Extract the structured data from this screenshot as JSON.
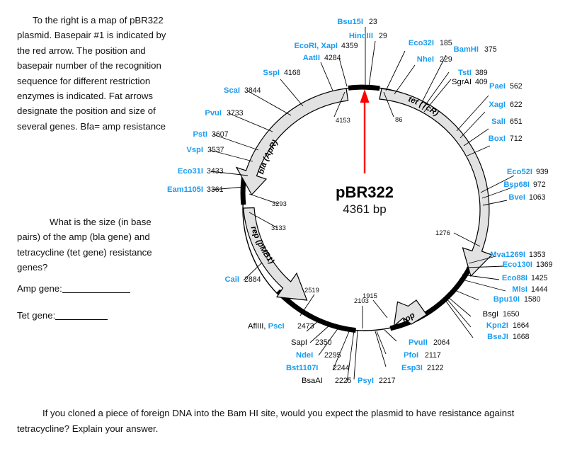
{
  "document": {
    "intro_paragraph": "To the right is a map of pBR322 plasmid.   Basepair #1 is indicated by the red arrow. The position and basepair number of the recognition sequence for different restriction enzymes is indicated.  Fat arrows designate the position and size of several genes. Bfa= amp resistance",
    "question_paragraph": "What is the size (in base pairs) of the amp (bla gene)  and tetracycline (tet gene) resistance genes?",
    "amp_blank_label": "Amp gene:",
    "tet_blank_label": "Tet gene:",
    "footer_paragraph": "If you cloned a piece of foreign DNA into the Bam HI site, would you expect the plasmid to have resistance against tetracycline?  Explain your answer."
  },
  "map": {
    "plasmid_name": "pBR322",
    "plasmid_size": "4361 bp",
    "origin_arrow_color": "#ff0000",
    "enzyme_label_color": "#1b9cf0",
    "gene_fill": "#e2e2e2",
    "backbone_color": "#000000",
    "genes": [
      {
        "name": "bla (ApR)",
        "start": 4153,
        "end": 3293
      },
      {
        "name": "tet (TcR)",
        "start": 86,
        "end": 1276
      },
      {
        "name": "rep (pMB1)",
        "start": 3133,
        "end": 2519
      },
      {
        "name": "rop",
        "start": 1915,
        "end": 2103
      }
    ],
    "gene_boundary_numbers": [
      "4153",
      "86",
      "1276",
      "3293",
      "3133",
      "2519",
      "1915",
      "2103"
    ],
    "sites": [
      {
        "enzyme": "Bsu15I",
        "position": "23",
        "blue": true
      },
      {
        "enzyme": "HindIII",
        "position": "29",
        "blue": true
      },
      {
        "enzyme": "Eco32I",
        "position": "185",
        "blue": true
      },
      {
        "enzyme": "NheI",
        "position": "229",
        "blue": true
      },
      {
        "enzyme": "BamHI",
        "position": "375",
        "blue": true
      },
      {
        "enzyme": "TstI",
        "position": "389",
        "blue": true
      },
      {
        "enzyme": "SgrAI",
        "position": "409",
        "blue": false
      },
      {
        "enzyme": "PaeI",
        "position": "562",
        "blue": true
      },
      {
        "enzyme": "XagI",
        "position": "622",
        "blue": true
      },
      {
        "enzyme": "SalI",
        "position": "651",
        "blue": true
      },
      {
        "enzyme": "BoxI",
        "position": "712",
        "blue": true
      },
      {
        "enzyme": "Eco52I",
        "position": "939",
        "blue": true
      },
      {
        "enzyme": "Bsp68I",
        "position": "972",
        "blue": true
      },
      {
        "enzyme": "BveI",
        "position": "1063",
        "blue": true
      },
      {
        "enzyme": "Mva1269I",
        "position": "1353",
        "blue": true
      },
      {
        "enzyme": "Eco130I",
        "position": "1369",
        "blue": true
      },
      {
        "enzyme": "Eco88I",
        "position": "1425",
        "blue": true
      },
      {
        "enzyme": "MlsI",
        "position": "1444",
        "blue": true
      },
      {
        "enzyme": "Bpu10I",
        "position": "1580",
        "blue": true
      },
      {
        "enzyme": "BsgI",
        "position": "1650",
        "blue": false
      },
      {
        "enzyme": "Kpn2I",
        "position": "1664",
        "blue": true
      },
      {
        "enzyme": "BseJI",
        "position": "1668",
        "blue": true
      },
      {
        "enzyme": "PvuII",
        "position": "2064",
        "blue": true
      },
      {
        "enzyme": "PfoI",
        "position": "2117",
        "blue": true
      },
      {
        "enzyme": "Esp3I",
        "position": "2122",
        "blue": true
      },
      {
        "enzyme": "PsyI",
        "position": "2217",
        "blue": true
      },
      {
        "enzyme": "BsaAI",
        "position": "2225",
        "blue": false
      },
      {
        "enzyme": "Bst1107I",
        "position": "2244",
        "blue": true
      },
      {
        "enzyme": "NdeI",
        "position": "2295",
        "blue": true
      },
      {
        "enzyme": "SapI",
        "position": "2350",
        "blue": false
      },
      {
        "enzyme": "AflIII, PscI",
        "position": "2473",
        "blue": true
      },
      {
        "enzyme": "CaiI",
        "position": "2884",
        "blue": true
      },
      {
        "enzyme": "Eam1105I",
        "position": "3361",
        "blue": true
      },
      {
        "enzyme": "Eco31I",
        "position": "3433",
        "blue": true
      },
      {
        "enzyme": "VspI",
        "position": "3537",
        "blue": true
      },
      {
        "enzyme": "PstI",
        "position": "3607",
        "blue": true
      },
      {
        "enzyme": "PvuI",
        "position": "3733",
        "blue": true
      },
      {
        "enzyme": "ScaI",
        "position": "3844",
        "blue": true
      },
      {
        "enzyme": "SspI",
        "position": "4168",
        "blue": true
      },
      {
        "enzyme": "AatII",
        "position": "4284",
        "blue": true
      },
      {
        "enzyme": "EcoRI, XapI",
        "position": "4359",
        "blue": true
      }
    ],
    "labels": {
      "top_left_group": [
        "EcoRI, XapI",
        "AatII",
        "SspI"
      ],
      "top_group": [
        "Bsu15I",
        "HindIII",
        "Eco32I",
        "NheI",
        "BamHI",
        "TstI",
        "SgrAI"
      ]
    }
  }
}
